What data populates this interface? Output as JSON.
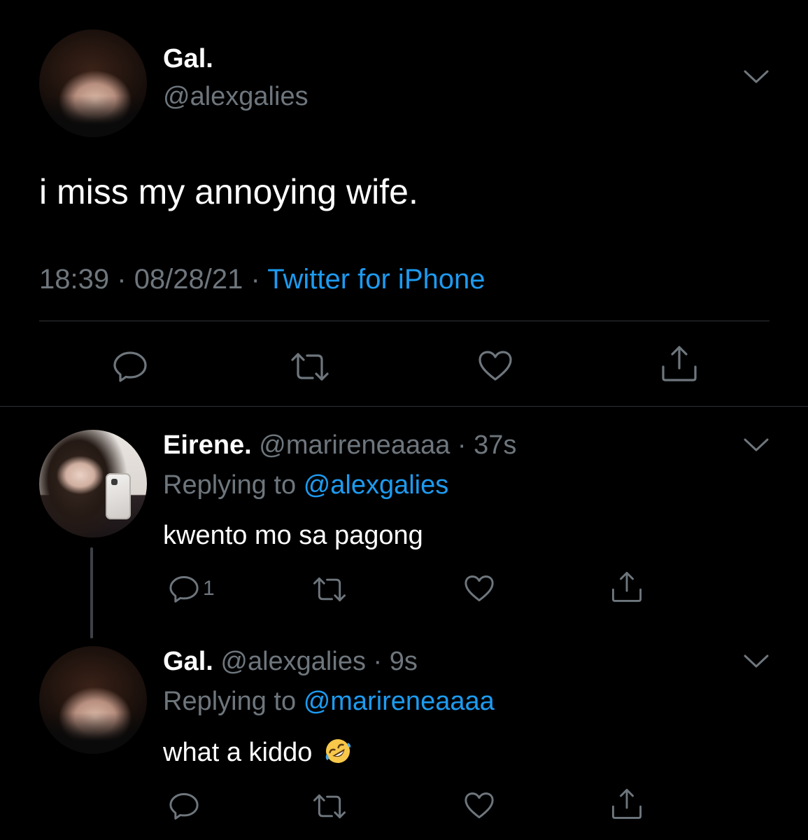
{
  "main_tweet": {
    "name": "Gal.",
    "handle": "@alexgalies",
    "text": "i miss my annoying wife.",
    "time": "18:39",
    "date": "08/28/21",
    "separator": "·",
    "source": "Twitter for iPhone"
  },
  "replies": [
    {
      "name": "Eirene.",
      "handle": "@marireneaaaa",
      "age": "37s",
      "replying_prefix": "Replying to",
      "replying_to": "@alexgalies",
      "text": "kwento mo sa pagong",
      "reply_count": "1"
    },
    {
      "name": "Gal.",
      "handle": "@alexgalies",
      "age": "9s",
      "replying_prefix": "Replying to",
      "replying_to": "@marireneaaaa",
      "text": "what a kiddo",
      "emoji": "rolling-on-the-floor-laughing"
    }
  ],
  "icons": {
    "reply": "reply-icon",
    "retweet": "retweet-icon",
    "like": "heart-icon",
    "share": "share-icon",
    "more": "chevron-down-icon"
  },
  "colors": {
    "background": "#000000",
    "text": "#ffffff",
    "muted": "#6e767d",
    "link": "#1d9bf0",
    "divider": "#2f3336"
  }
}
